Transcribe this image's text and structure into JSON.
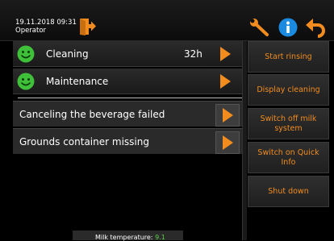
{
  "header": {
    "datetime": "19.11.2018 09:31",
    "user": "Operator",
    "icons": [
      "logout-icon",
      "wrench-icon",
      "info-icon",
      "back-arrow-icon"
    ]
  },
  "status_rows": [
    {
      "label": "Cleaning",
      "value": "32h",
      "state_icon": "smiley-icon"
    },
    {
      "label": "Maintenance",
      "value": "",
      "state_icon": "smiley-icon"
    }
  ],
  "messages": [
    {
      "label": "Canceling the beverage failed"
    },
    {
      "label": "Grounds container missing"
    }
  ],
  "sidebar": {
    "buttons": [
      {
        "label": "Start rinsing"
      },
      {
        "label": "Display cleaning"
      },
      {
        "label": "Switch off milk system"
      },
      {
        "label": "Switch on Quick Info"
      },
      {
        "label": "Shut down"
      }
    ]
  },
  "footer": {
    "milk_label": "Milk temperature:",
    "milk_value": "9.1"
  },
  "colors": {
    "accent": "#f28c1e",
    "status_ok": "#3fbf3a",
    "info": "#1a8be0",
    "value_green": "#5ad247"
  }
}
